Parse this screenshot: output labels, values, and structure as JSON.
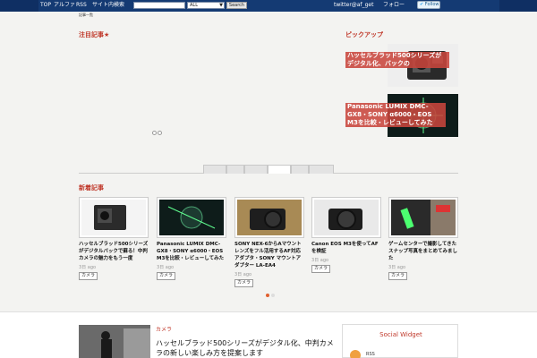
{
  "topbar": {
    "top_link": "TOP",
    "site_label": "アルファ",
    "rss_label": "RSS",
    "search_label": "サイト内検索",
    "select_value": "ALL",
    "search_button": "Search",
    "twitter_text": "twitter@af_get",
    "follow_label": "フォロー",
    "follow_button": "Follow",
    "sub_note": "記事一覧"
  },
  "slider": {
    "heading": "注目記事★"
  },
  "pickup": {
    "heading": "ピックアップ",
    "items": [
      {
        "label": "ハッセルブラッド500シリーズがデジタル化、バックの"
      },
      {
        "label": "Panasonic LUMIX DMC-GX8・SONY α6000・EOS M3を比較・レビューしてみた"
      }
    ]
  },
  "new_section": {
    "heading": "新着記事"
  },
  "cards": [
    {
      "title": "ハッセルブラッド500シリーズがデジタルバックで蘇る！中判カメラの魅力をもう一度",
      "time": "3日 ago",
      "tag": "カメラ"
    },
    {
      "title": "Panasonic LUMIX DMC-GX8・SONY α6000・EOS M3を比較・レビューしてみた",
      "time": "3日 ago",
      "tag": "カメラ"
    },
    {
      "title": "SONY NEX-6からAマウントレンズをフル活用するAF対応アダプタ・SONY マウントアダプター LA-EA4",
      "time": "3日 ago",
      "tag": "カメラ"
    },
    {
      "title": "Canon EOS M3を使ってAFを検証",
      "time": "3日 ago",
      "tag": "カメラ"
    },
    {
      "title": "ゲームセンターで撮影してきたスナップ写真をまとめてみました",
      "time": "3日 ago",
      "tag": "カメラ"
    }
  ],
  "bottom": {
    "tag": "カメラ",
    "title": "ハッセルブラッド500シリーズがデジタル化、中判カメラの新しい楽しみ方を提案します"
  },
  "widget": {
    "title": "Social Widget",
    "rss_label": "RSS"
  },
  "colors": {
    "accent": "#c0392b",
    "topbar": "#143a73"
  }
}
